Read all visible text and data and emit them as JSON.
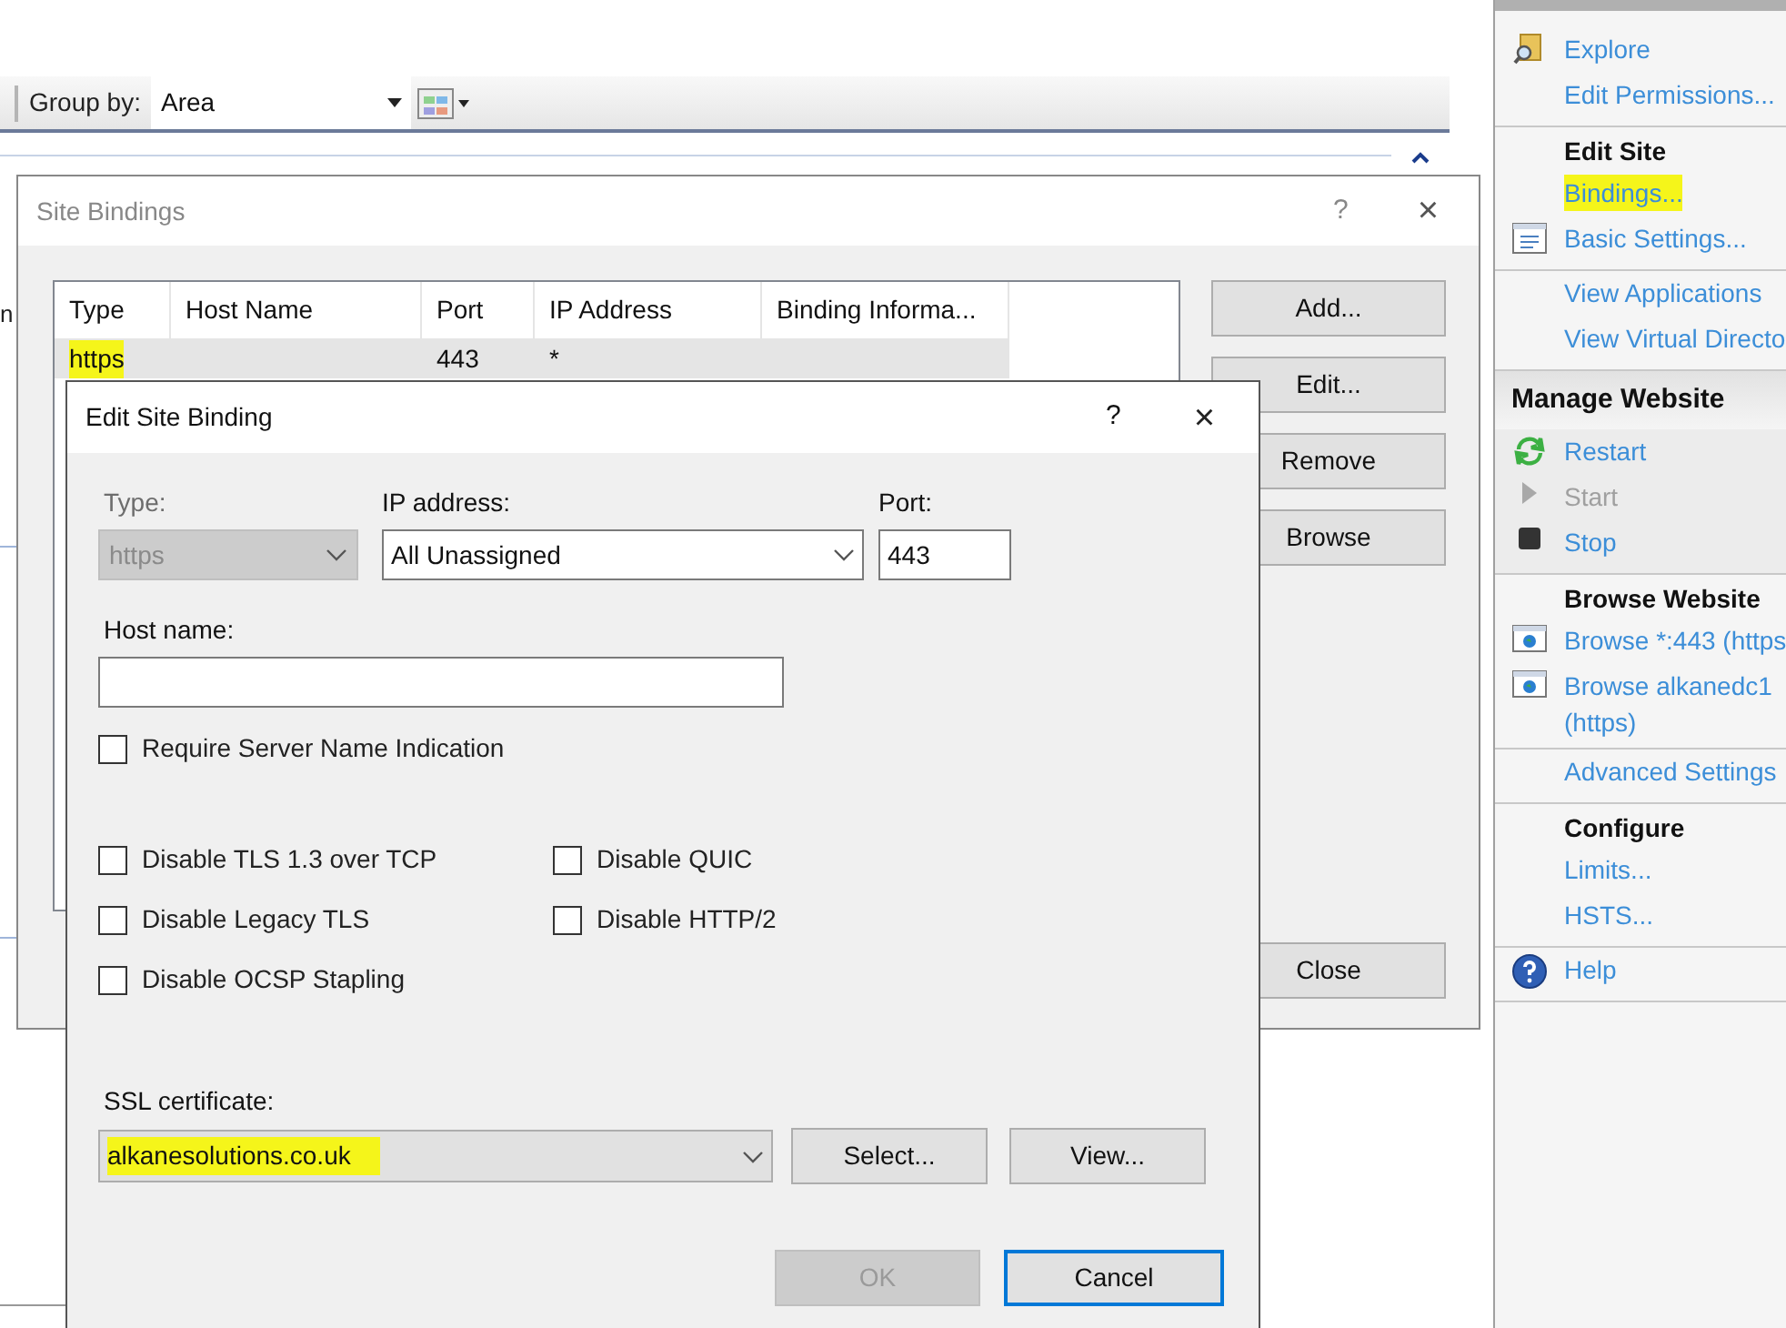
{
  "background": {
    "cut_text": "n",
    "group_by": {
      "label": "Group by:",
      "value": "Area"
    }
  },
  "site_bindings": {
    "title": "Site Bindings",
    "help": "?",
    "close": "×",
    "columns": [
      "Type",
      "Host Name",
      "Port",
      "IP Address",
      "Binding Informa..."
    ],
    "rows": [
      {
        "cells": [
          "https",
          "",
          "443",
          "*",
          ""
        ],
        "selected": true,
        "highlighted": true
      }
    ],
    "buttons": [
      "Add...",
      "Edit...",
      "Remove",
      "Browse"
    ],
    "close_button": "Close"
  },
  "edit_binding": {
    "title": "Edit Site Binding",
    "help": "?",
    "close": "×",
    "type": {
      "label": "Type:",
      "value": "https",
      "disabled": true
    },
    "ip": {
      "label": "IP address:",
      "value": "All Unassigned"
    },
    "port": {
      "label": "Port:",
      "value": "443"
    },
    "host": {
      "label": "Host name:"
    },
    "sni": {
      "label": "Require Server Name Indication",
      "checked": false
    },
    "options": [
      {
        "label": "Disable TLS 1.3 over TCP",
        "checked": false
      },
      {
        "label": "Disable QUIC",
        "checked": false
      },
      {
        "label": "Disable Legacy TLS",
        "checked": false
      },
      {
        "label": "Disable HTTP/2",
        "checked": false
      },
      {
        "label": "Disable OCSP Stapling",
        "checked": false
      }
    ],
    "ssl": {
      "label": "SSL certificate:",
      "value": "alkanesolutions.co.uk",
      "highlighted": true,
      "select": "Select...",
      "view": "View..."
    },
    "ok": {
      "label": "OK",
      "disabled": true
    },
    "cancel": {
      "label": "Cancel",
      "default": true
    }
  },
  "actions": [
    {
      "items": [
        {
          "label": "Explore",
          "disabled": false,
          "highlighted": false
        },
        {
          "label": "Edit Permissions...",
          "disabled": false,
          "highlighted": false
        }
      ]
    },
    {
      "heading": "Edit Site",
      "items": [
        {
          "label": "Bindings...",
          "disabled": false,
          "highlighted": true
        },
        {
          "label": "Basic Settings...",
          "disabled": false,
          "highlighted": false
        }
      ]
    },
    {
      "items": [
        {
          "label": "View Applications",
          "disabled": false,
          "highlighted": false
        },
        {
          "label": "View Virtual Directo",
          "disabled": false,
          "highlighted": false
        }
      ]
    },
    {
      "section": "Manage Website",
      "items": [
        {
          "label": "Restart",
          "disabled": false,
          "highlighted": false
        },
        {
          "label": "Start",
          "disabled": true,
          "highlighted": false
        },
        {
          "label": "Stop",
          "disabled": false,
          "highlighted": false
        }
      ]
    },
    {
      "heading": "Browse Website",
      "items": [
        {
          "label": "Browse *:443 (https",
          "disabled": false,
          "highlighted": false
        },
        {
          "label": "Browse alkanedc1\n(https)",
          "disabled": false,
          "highlighted": false
        }
      ]
    },
    {
      "items": [
        {
          "label": "Advanced Settings",
          "disabled": false,
          "highlighted": false
        }
      ]
    },
    {
      "heading": "Configure",
      "items": [
        {
          "label": "Limits...",
          "disabled": false,
          "highlighted": false
        },
        {
          "label": "HSTS...",
          "disabled": false,
          "highlighted": false
        }
      ]
    },
    {
      "items": [
        {
          "label": "Help",
          "disabled": false,
          "highlighted": false
        }
      ]
    }
  ]
}
